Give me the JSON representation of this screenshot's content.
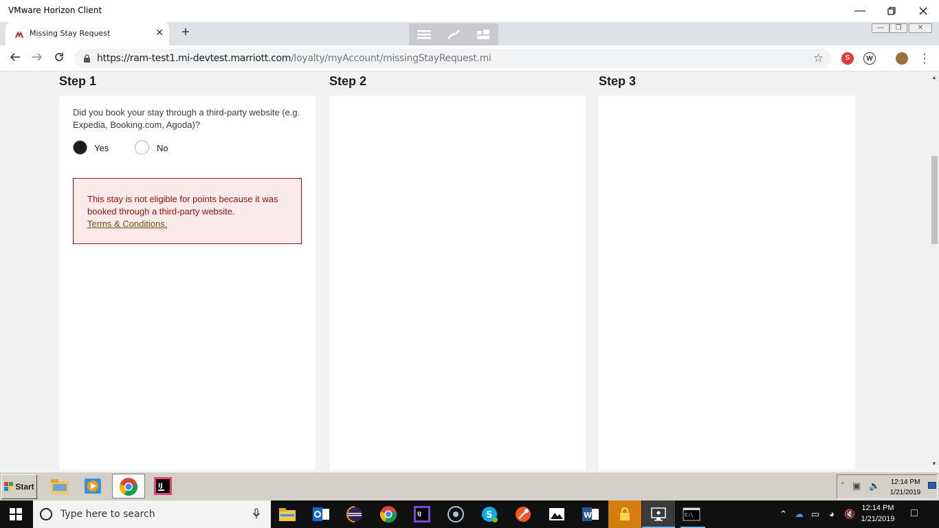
{
  "window": {
    "title": "VMware Horizon Client"
  },
  "browser": {
    "tab_title": "Missing Stay Request",
    "url_host": "https://ram-test1.mi-devtest.marriott.com",
    "url_path": "/loyalty/myAccount/missingStayRequest.mi"
  },
  "steps": [
    {
      "heading": "Step 1"
    },
    {
      "heading": "Step 2"
    },
    {
      "heading": "Step 3"
    }
  ],
  "form": {
    "question": "Did you book your stay through a third-party website (e.g. Expedia, Booking.com, Agoda)?",
    "options": [
      {
        "label": "Yes",
        "selected": true
      },
      {
        "label": "No",
        "selected": false
      }
    ],
    "alert_text": "This stay is not eligible for points because it was booked through a third-party website.",
    "alert_link": "Terms & Conditions."
  },
  "remote_taskbar": {
    "start_label": "Start",
    "time": "12:14 PM",
    "date": "1/21/2019"
  },
  "os_taskbar": {
    "search_placeholder": "Type here to search",
    "time": "12:14 PM",
    "date": "1/21/2019"
  },
  "colors": {
    "alert_bg": "#fbeaea",
    "alert_border": "#b00020",
    "alert_text": "#9d1010",
    "link": "#7a4b10",
    "page_bg": "#f2f2f2"
  }
}
